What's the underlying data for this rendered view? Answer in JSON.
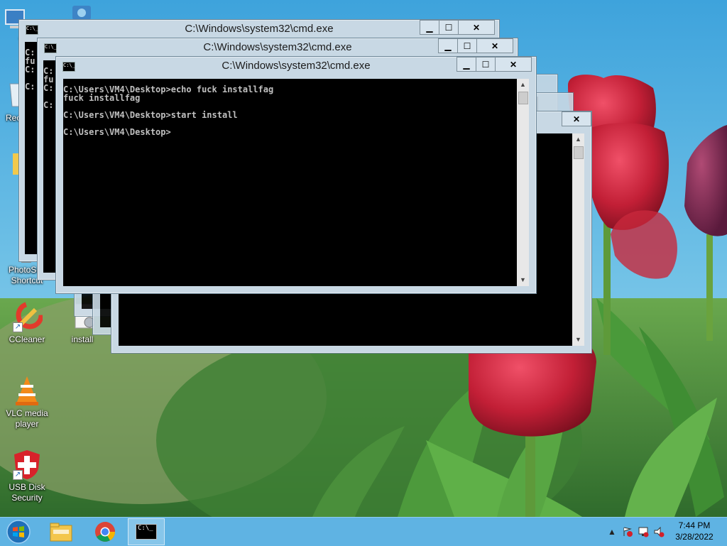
{
  "desktop": {
    "icons": [
      {
        "name": "PhotoScape",
        "line1": "PhotoSca",
        "line2": "Shortcut"
      },
      {
        "name": "CCleaner",
        "line1": "CCleaner",
        "line2": ""
      },
      {
        "name": "install",
        "line1": "install",
        "line2": ""
      },
      {
        "name": "VLC",
        "line1": "VLC media",
        "line2": "player"
      },
      {
        "name": "USB Disk Security",
        "line1": "USB Disk",
        "line2": "Security"
      }
    ],
    "partial_labels": {
      "top": "T",
      "recycle": "Rec"
    }
  },
  "windows": {
    "title": "C:\\Windows\\system32\\cmd.exe",
    "minimize_glyph": "▁",
    "maximize_glyph": "☐",
    "close_glyph": "✕",
    "back_console_text": "C:\nfu\nC:\n\nC:",
    "mid_console_text": "C:\nfu\nC:\n\nC:",
    "front_console_text": "C:\\Users\\VM4\\Desktop>echo fuck installfag\nfuck installfag\n\nC:\\Users\\VM4\\Desktop>start install\n\nC:\\Users\\VM4\\Desktop>",
    "title_icon_text": "C:\\_"
  },
  "taskbar": {
    "clock_time": "7:44 PM",
    "clock_date": "3/28/2022",
    "cmd_button_icon_text": "C:\\_"
  },
  "colors": {
    "sky": "#4aa8dc",
    "taskbar": "#5fb3e3",
    "tulip": "#c8283c",
    "leaf": "#3a8c38",
    "window_frame": "#c8d8e4"
  }
}
